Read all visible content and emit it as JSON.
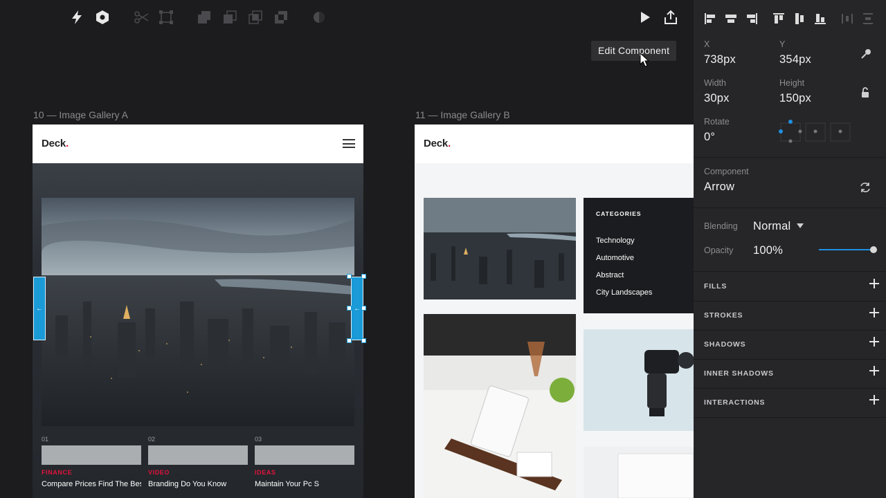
{
  "toolbar": {
    "icons": [
      "lightning-icon",
      "hexagon-icon",
      "scissors-icon",
      "transform-icon",
      "union-icon",
      "subtract-icon",
      "intersect-icon",
      "difference-icon",
      "mask-icon",
      "play-icon",
      "share-icon"
    ],
    "tooltip": "Edit Component"
  },
  "canvas": {
    "artboard_a": {
      "label": "10 — Image Gallery A",
      "logo": "Deck",
      "logo_dot": ".",
      "cards": [
        {
          "num": "01",
          "tag": "FINANCE",
          "title": "Compare Prices Find The Best"
        },
        {
          "num": "02",
          "tag": "VIDEO",
          "title": "Branding Do You Know"
        },
        {
          "num": "03",
          "tag": "IDEAS",
          "title": "Maintain Your Pc S"
        }
      ]
    },
    "artboard_b": {
      "label": "11 — Image Gallery B",
      "logo": "Deck",
      "logo_dot": ".",
      "categories_title": "CATEGORIES",
      "categories": [
        "Technology",
        "Automotive",
        "Abstract",
        "City Landscapes"
      ]
    },
    "arrow_glyph": "←"
  },
  "inspector": {
    "x_label": "X",
    "x_value": "738px",
    "y_label": "Y",
    "y_value": "354px",
    "width_label": "Width",
    "width_value": "30px",
    "height_label": "Height",
    "height_value": "150px",
    "rotate_label": "Rotate",
    "rotate_value": "0°",
    "component_label": "Component",
    "component_value": "Arrow",
    "blending_label": "Blending",
    "blending_value": "Normal",
    "opacity_label": "Opacity",
    "opacity_value": "100%",
    "opacity_level": 1.0,
    "sections": [
      "FILLS",
      "STROKES",
      "SHADOWS",
      "INNER SHADOWS",
      "INTERACTIONS"
    ],
    "accent_color": "#1a9ad6"
  }
}
